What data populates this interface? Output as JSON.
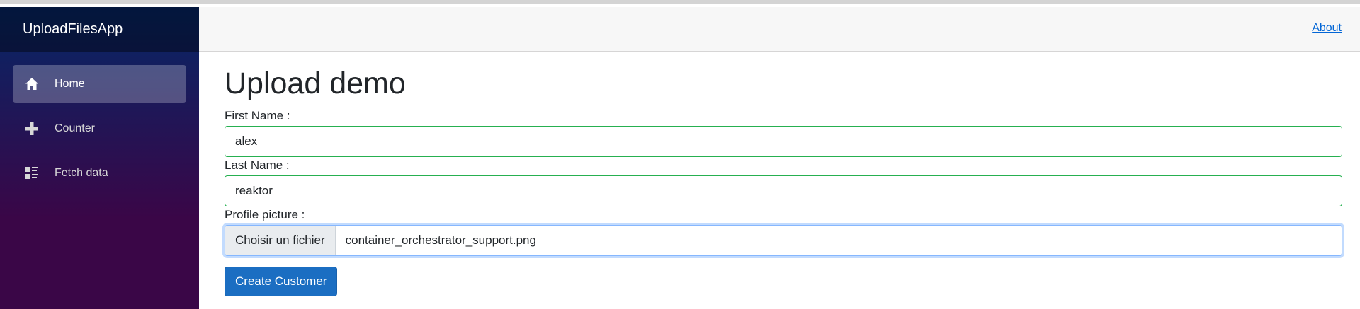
{
  "app": {
    "brand": "UploadFilesApp"
  },
  "sidebar": {
    "items": [
      {
        "label": "Home",
        "icon": "home-icon",
        "active": true
      },
      {
        "label": "Counter",
        "icon": "plus-icon",
        "active": false
      },
      {
        "label": "Fetch data",
        "icon": "list-rich-icon",
        "active": false
      }
    ]
  },
  "topbar": {
    "about_label": "About"
  },
  "main": {
    "title": "Upload demo",
    "first_name_label": "First Name :",
    "first_name_value": "alex",
    "last_name_label": "Last Name :",
    "last_name_value": "reaktor",
    "profile_label": "Profile picture :",
    "file_button_label": "Choisir un fichier",
    "file_name": "container_orchestrator_support.png",
    "submit_label": "Create Customer"
  },
  "colors": {
    "sidebar_gradient_top": "#052767",
    "sidebar_gradient_bottom": "#3a0647",
    "valid_border": "#26b050",
    "link": "#0366d6",
    "primary_button": "#1b6ec2"
  }
}
